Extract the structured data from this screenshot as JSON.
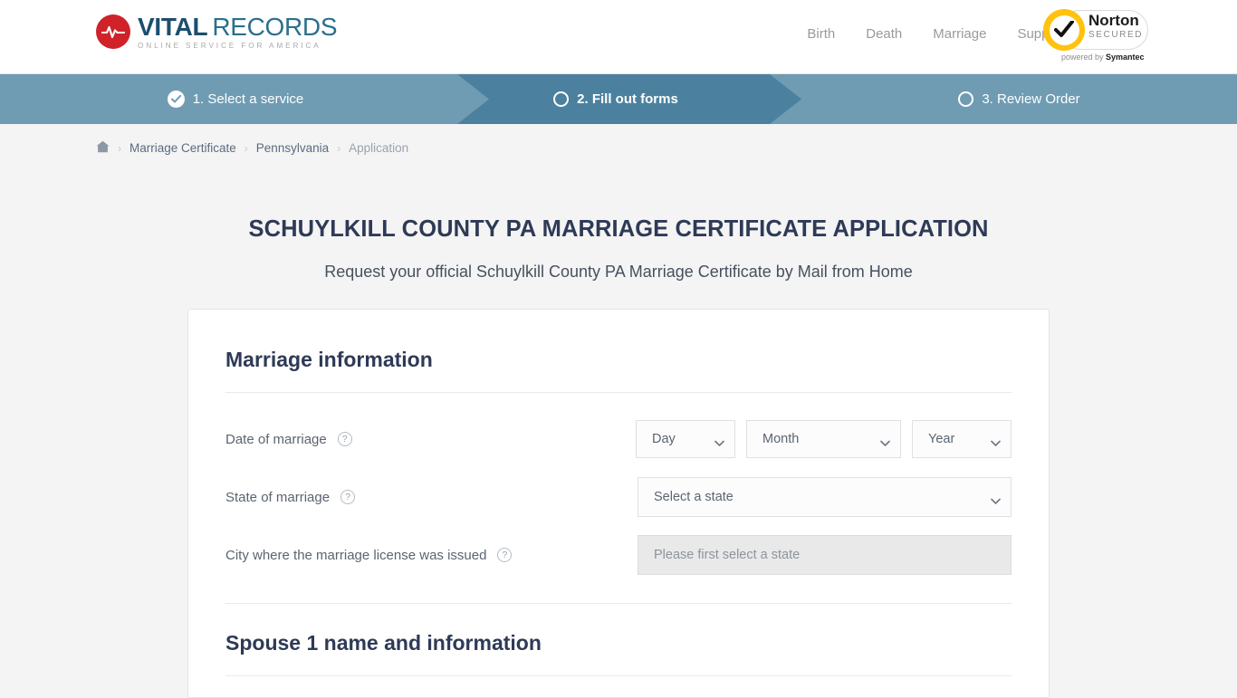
{
  "header": {
    "logo": {
      "word1": "VITAL",
      "word2": "RECORDS",
      "tagline": "ONLINE SERVICE FOR AMERICA",
      "mark_icon": "heartbeat-icon"
    },
    "nav": [
      {
        "label": "Birth"
      },
      {
        "label": "Death"
      },
      {
        "label": "Marriage"
      },
      {
        "label": "Support"
      }
    ],
    "norton": {
      "name": "Norton",
      "secured": "SECURED",
      "powered": "powered by ",
      "brand": "Symantec",
      "check_icon": "checkmark-icon"
    }
  },
  "steps": [
    {
      "label": "1. Select a service",
      "state": "complete",
      "icon": "check-circle-icon"
    },
    {
      "label": "2. Fill out forms",
      "state": "active",
      "icon": "empty-circle-icon"
    },
    {
      "label": "3. Review Order",
      "state": "pending",
      "icon": "empty-circle-icon"
    }
  ],
  "breadcrumb": {
    "home_icon": "home-icon",
    "separator": "›",
    "items": [
      {
        "label": "Marriage Certificate",
        "current": false
      },
      {
        "label": "Pennsylvania",
        "current": false
      },
      {
        "label": "Application",
        "current": true
      }
    ]
  },
  "page": {
    "title": "SCHUYLKILL COUNTY PA MARRIAGE CERTIFICATE APPLICATION",
    "subtitle": "Request your official Schuylkill County PA Marriage Certificate by Mail from Home"
  },
  "form": {
    "section1_title": "Marriage information",
    "section2_title": "Spouse 1 name and information",
    "help_glyph": "?",
    "fields": {
      "date_of_marriage": {
        "label": "Date of marriage",
        "day": "Day",
        "month": "Month",
        "year": "Year"
      },
      "state_of_marriage": {
        "label": "State of marriage",
        "value": "Select a state"
      },
      "city_license": {
        "label": "City where the marriage license was issued",
        "placeholder": "Please first select a state",
        "value": ""
      }
    }
  },
  "colors": {
    "brand_red": "#cf2229",
    "brand_blue": "#1c4e6e",
    "step_active": "#4b819e",
    "step_inactive": "#6f9cb3",
    "heading": "#2e3a56",
    "norton_yellow": "#ffc20e"
  }
}
